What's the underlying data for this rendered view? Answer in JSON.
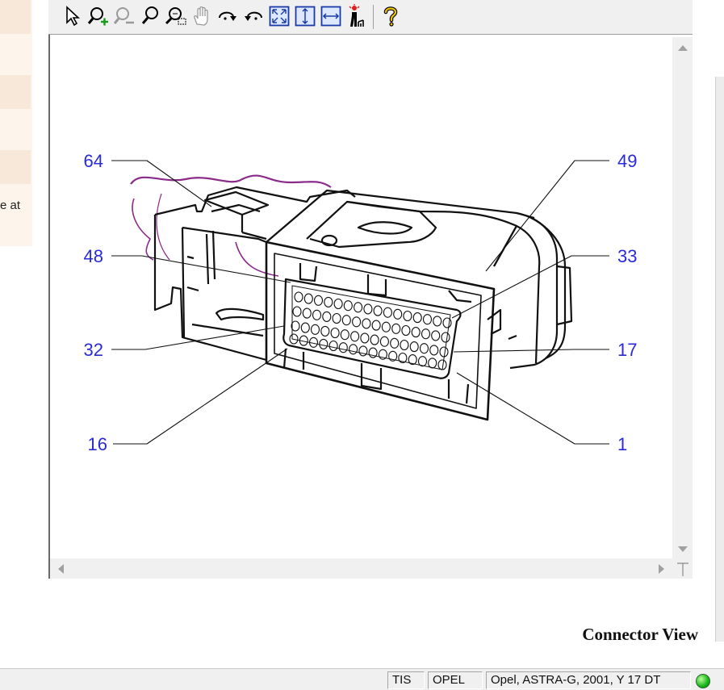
{
  "left_panel": {
    "fragment_text": "e at"
  },
  "toolbar": {
    "buttons": [
      {
        "name": "select-arrow-icon"
      },
      {
        "name": "zoom-in-icon"
      },
      {
        "name": "zoom-out-icon"
      },
      {
        "name": "zoom-icon"
      },
      {
        "name": "zoom-area-icon"
      },
      {
        "name": "pan-hand-icon"
      },
      {
        "name": "rotate-clockwise-icon"
      },
      {
        "name": "rotate-counterclockwise-icon"
      },
      {
        "name": "fit-page-icon"
      },
      {
        "name": "fit-height-icon"
      },
      {
        "name": "fit-width-icon"
      },
      {
        "name": "highlight-icon"
      },
      {
        "name": "help-icon"
      }
    ]
  },
  "diagram": {
    "pin_labels": {
      "p64": "64",
      "p48": "48",
      "p32": "32",
      "p16": "16",
      "p49": "49",
      "p33": "33",
      "p17": "17",
      "p1": "1"
    },
    "colors": {
      "label": "#2a2ad8",
      "wire": "#8a2a8a",
      "line": "#111111"
    }
  },
  "caption": "Connector View",
  "statusbar": {
    "cells": [
      "TIS",
      "OPEL",
      "Opel, ASTRA-G, 2001, Y 17 DT"
    ],
    "status_led_color": "#18b418"
  }
}
